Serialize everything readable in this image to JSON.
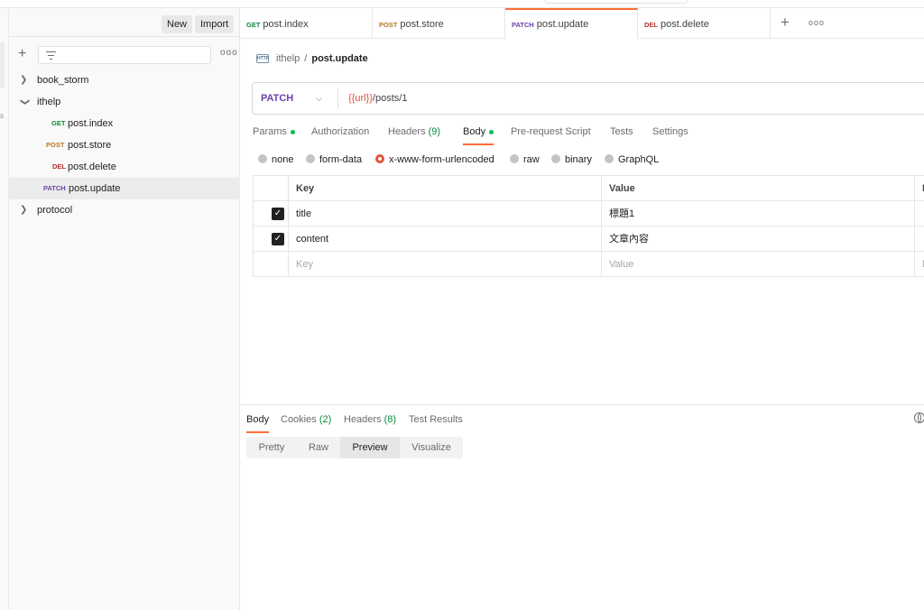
{
  "sidebar": {
    "new_label": "New",
    "import_label": "Import",
    "more_label": "ooo",
    "tree": [
      {
        "label": "book_storm",
        "expanded": false
      },
      {
        "label": "ithelp",
        "expanded": true
      },
      {
        "method": "GET",
        "label": "post.index"
      },
      {
        "method": "POST",
        "label": "post.store"
      },
      {
        "method": "DEL",
        "label": "post.delete"
      },
      {
        "method": "PATCH",
        "label": "post.update",
        "selected": true
      },
      {
        "label": "protocol",
        "expanded": false
      }
    ]
  },
  "tabs": [
    {
      "method": "GET",
      "label": "post.index"
    },
    {
      "method": "POST",
      "label": "post.store"
    },
    {
      "method": "PATCH",
      "label": "post.update",
      "active": true
    },
    {
      "method": "DEL",
      "label": "post.delete"
    }
  ],
  "tab_more_label": "ooo",
  "request": {
    "icon_label": "HTTP",
    "breadcrumb_parent": "ithelp",
    "breadcrumb_sep": "/",
    "breadcrumb_current": "post.update",
    "method": "PATCH",
    "url_variable": "{{url}}",
    "url_path": "/posts/1",
    "tabs": {
      "params": "Params",
      "authorization": "Authorization",
      "headers": "Headers",
      "headers_count": "(9)",
      "body": "Body",
      "prerequest": "Pre-request Script",
      "tests": "Tests",
      "settings": "Settings"
    },
    "body_types": [
      "none",
      "form-data",
      "x-www-form-urlencoded",
      "raw",
      "binary",
      "GraphQL"
    ],
    "selected_body_type": "x-www-form-urlencoded",
    "table": {
      "header_key": "Key",
      "header_value": "Value",
      "header_desc": "D",
      "rows": [
        {
          "checked": true,
          "key": "title",
          "value": "標題1"
        },
        {
          "checked": true,
          "key": "content",
          "value": "文章內容"
        }
      ],
      "placeholder_key": "Key",
      "placeholder_value": "Value",
      "placeholder_desc": "D"
    }
  },
  "response": {
    "tabs": {
      "body": "Body",
      "cookies": "Cookies",
      "cookies_count": "(2)",
      "headers": "Headers",
      "headers_count": "(8)",
      "test_results": "Test Results"
    },
    "views": [
      "Pretty",
      "Raw",
      "Preview",
      "Visualize"
    ],
    "selected_view": "Preview"
  }
}
